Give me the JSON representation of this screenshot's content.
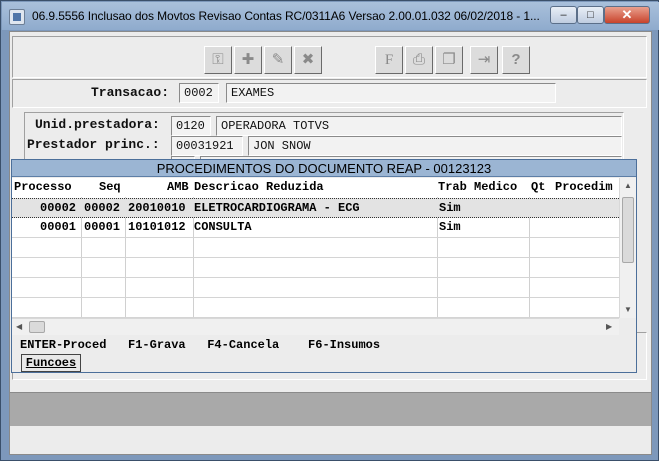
{
  "window": {
    "title": "06.9.5556  Inclusao  dos Movtos Revisao Contas RC/0311A6 Versao 2.00.01.032 06/02/2018 - 1...",
    "min_glyph": "–",
    "max_glyph": "□",
    "close_glyph": "✕"
  },
  "toolbar": {
    "buttons": [
      {
        "name": "key-icon",
        "glyph": "⚿"
      },
      {
        "name": "add-icon",
        "glyph": "✚"
      },
      {
        "name": "edit-icon",
        "glyph": "✎"
      },
      {
        "name": "delete-icon",
        "glyph": "✖"
      },
      {
        "name": "filter-icon",
        "glyph": "F"
      },
      {
        "name": "print-icon",
        "glyph": "⎙"
      },
      {
        "name": "copy-icon",
        "glyph": "❐"
      },
      {
        "name": "exit-icon",
        "glyph": "⇥"
      },
      {
        "name": "help-icon",
        "glyph": "?"
      }
    ]
  },
  "form": {
    "transacao_label": "Transacao:",
    "transacao_code": "0002",
    "transacao_desc": "EXAMES",
    "unid_label": "Unid.prestadora:",
    "unid_code": "0120",
    "unid_desc": "OPERADORA TOTVS",
    "prestador_label": "Prestador princ.:",
    "prestador_code": "00031921",
    "prestador_desc": "JON SNOW"
  },
  "dialog": {
    "title": "PROCEDIMENTOS DO DOCUMENTO REAP - 00123123",
    "columns": [
      "Processo",
      "Seq",
      "AMB",
      "Descricao Reduzida",
      "Trab Medico",
      "Qt",
      "Procedim"
    ],
    "rows": [
      {
        "processo": "00002",
        "seq": "00002",
        "amb": "20010010",
        "descricao": "ELETROCARDIOGRAMA - ECG",
        "trab_medico": "Sim",
        "qt": "",
        "procedim": "",
        "selected": true
      },
      {
        "processo": "00001",
        "seq": "00001",
        "amb": "10101012",
        "descricao": "CONSULTA",
        "trab_medico": "Sim",
        "qt": "",
        "procedim": "",
        "selected": false
      }
    ],
    "keys": "ENTER-Proced   F1-Grava   F4-Cancela    F6-Insumos",
    "funcoes_label": "Funcoes"
  }
}
